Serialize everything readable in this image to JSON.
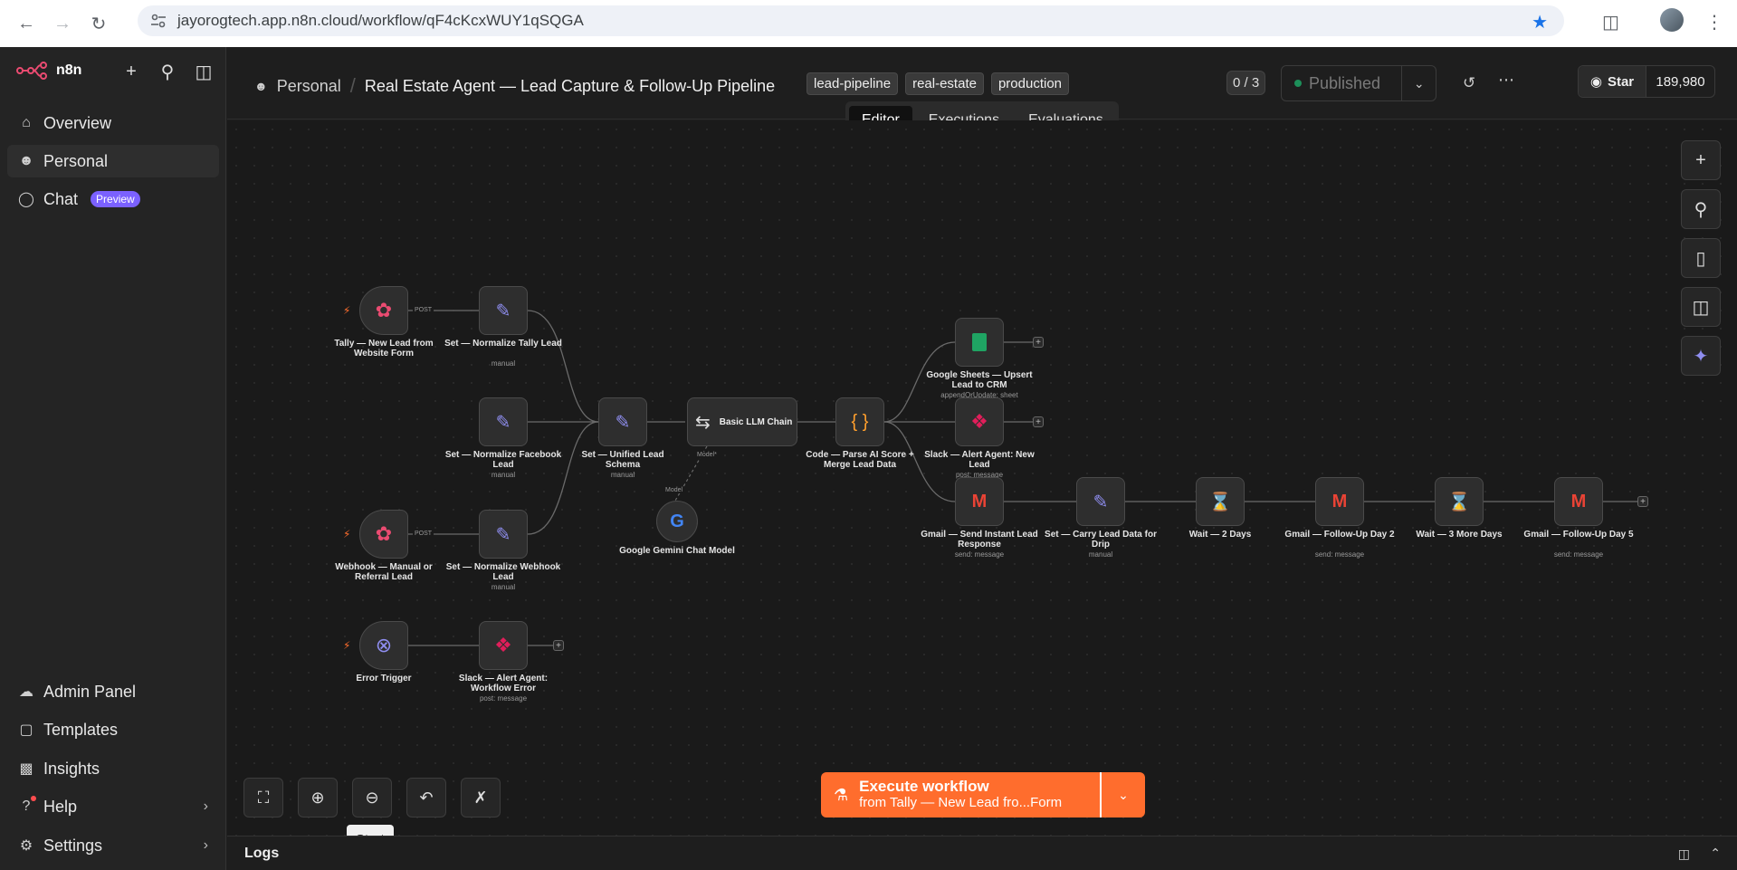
{
  "browser": {
    "url": "jayorogtech.app.n8n.cloud/workflow/qF4cKcxWUY1qSQGA"
  },
  "sidebar": {
    "brand": "n8n",
    "items": [
      {
        "label": "Overview",
        "icon": "home-icon"
      },
      {
        "label": "Personal",
        "icon": "user-icon"
      },
      {
        "label": "Chat",
        "icon": "chat-icon",
        "badge": "Preview"
      }
    ],
    "bottom_items": [
      {
        "label": "Admin Panel",
        "icon": "cloud-icon"
      },
      {
        "label": "Templates",
        "icon": "box-icon"
      },
      {
        "label": "Insights",
        "icon": "chart-icon"
      },
      {
        "label": "Help",
        "icon": "help-icon"
      },
      {
        "label": "Settings",
        "icon": "gear-icon"
      }
    ]
  },
  "header": {
    "project": "Personal",
    "workflow_title": "Real Estate Agent — Lead Capture & Follow-Up Pipeline",
    "tags": [
      "lead-pipeline",
      "real-estate",
      "production"
    ],
    "counter": "0 / 3",
    "publish_label": "Published",
    "github_star": "Star",
    "github_count": "189,980",
    "tabs": [
      "Editor",
      "Executions",
      "Evaluations"
    ]
  },
  "nodes": {
    "tally": {
      "label": "Tally — New Lead from Website Form"
    },
    "set_tally": {
      "label": "Set — Normalize Tally Lead",
      "sub": "manual"
    },
    "set_facebook": {
      "label": "Set — Normalize Facebook Lead",
      "sub": "manual"
    },
    "webhook": {
      "label": "Webhook — Manual or Referral Lead"
    },
    "set_webhook": {
      "label": "Set — Normalize Webhook Lead",
      "sub": "manual"
    },
    "error_trigger": {
      "label": "Error Trigger"
    },
    "slack_error": {
      "label": "Slack — Alert Agent: Workflow Error",
      "sub": "post: message"
    },
    "set_unified": {
      "label": "Set — Unified Lead Schema",
      "sub": "manual"
    },
    "llm_chain": {
      "label": "Basic LLM Chain",
      "port_label": "Model*"
    },
    "gemini": {
      "label": "Google Gemini Chat Model",
      "port_label": "Model"
    },
    "code": {
      "label": "Code — Parse AI Score + Merge Lead Data"
    },
    "sheets": {
      "label": "Google Sheets — Upsert Lead to CRM",
      "sub": "appendOrUpdate: sheet"
    },
    "slack_lead": {
      "label": "Slack — Alert Agent: New Lead",
      "sub": "post: message"
    },
    "gmail_instant": {
      "label": "Gmail — Send Instant Lead Response",
      "sub": "send: message"
    },
    "set_carry": {
      "label": "Set — Carry Lead Data for Drip",
      "sub": "manual"
    },
    "wait2": {
      "label": "Wait — 2 Days"
    },
    "gmail_day2": {
      "label": "Gmail — Follow-Up Day 2",
      "sub": "send: message"
    },
    "wait3": {
      "label": "Wait — 3 More Days"
    },
    "gmail_day5": {
      "label": "Gmail — Follow-Up Day 5",
      "sub": "send: message"
    },
    "edge_post": "POST"
  },
  "canvas": {
    "execute_title": "Execute workflow",
    "execute_sub": "from Tally — New Lead fro...Form",
    "tooltip": "Start"
  },
  "logs": {
    "label": "Logs"
  }
}
